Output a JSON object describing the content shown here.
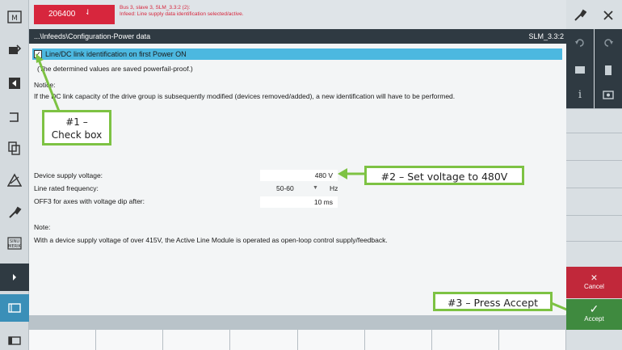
{
  "alarm": {
    "code": "206400",
    "arrow": "⇃",
    "line1": "Bus 3, slave 3, SLM_3.3:2 (2):",
    "line2": "Infeed: Line supply data identification selected/active."
  },
  "path": {
    "text": "...\\Infeeds\\Configuration-Power data",
    "component": "SLM_3.3:2"
  },
  "checkbox": {
    "label": "Line/DC link identification on first Power ON",
    "checked": "✓"
  },
  "info": {
    "saved_note": "(The determined values are saved powerfail-proof.)",
    "notice_title": "Notice:",
    "notice_text": "If the DC link capacity of the drive group is subsequently modified (devices removed/added), a new identification will have to be performed."
  },
  "fields": {
    "supply_voltage": {
      "label": "Device supply voltage:",
      "value": "480 V"
    },
    "line_frequency": {
      "label": "Line rated frequency:",
      "value": "50-60",
      "unit": "Hz"
    },
    "off3_delay": {
      "label": "OFF3 for axes with voltage dip after:",
      "value": "10 ms"
    }
  },
  "note": {
    "title": "Note:",
    "text": "With a device supply voltage of over 415V, the Active Line Module is operated as open-loop control supply/feedback."
  },
  "annotations": {
    "step1": "#1 –",
    "step1b": "Check box",
    "step2": "#2 – Set voltage to 480V",
    "step3": "#3 – Press Accept"
  },
  "buttons": {
    "cancel": "Cancel",
    "accept": "Accept",
    "cancel_icon": "×",
    "accept_icon": "✓",
    "info_icon": "i"
  },
  "colors": {
    "accent": "#4cb8e0",
    "alarm": "#d7263d",
    "callout": "#7dc243",
    "accept": "#3f8a3f",
    "cancel": "#c1283a"
  }
}
